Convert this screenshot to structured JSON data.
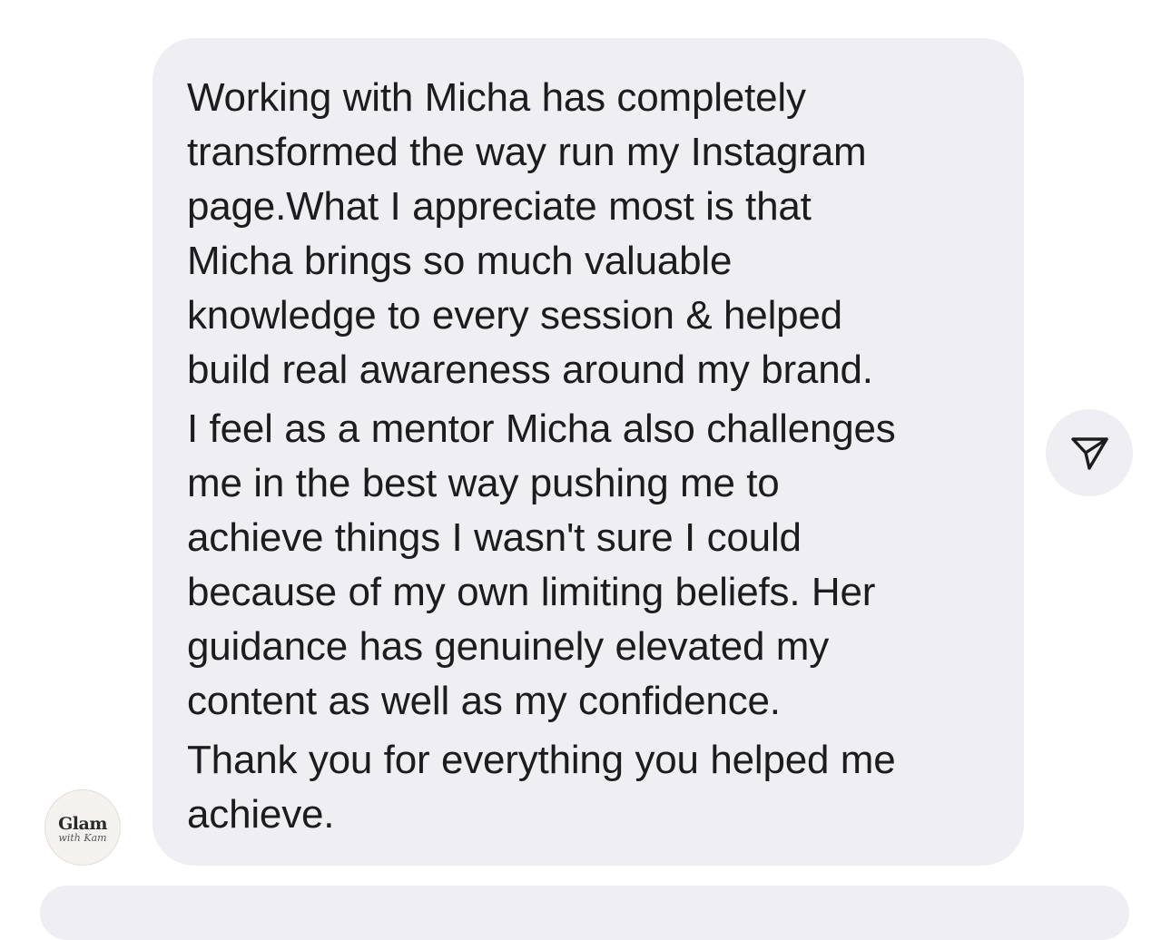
{
  "message": {
    "paragraphs": [
      {
        "lines": [
          "Working with Micha has completely",
          "transformed the way run my Instagram",
          "page.What I appreciate most is that",
          "Micha brings so much valuable",
          "knowledge to every session & helped",
          "build real awareness around my brand."
        ]
      },
      {
        "lines": [
          "I feel as a mentor Micha also challenges",
          "me in the best way pushing me to",
          "achieve things I wasn't sure I could",
          "because of my own limiting beliefs. Her",
          "guidance has genuinely elevated my",
          "content as well as my confidence."
        ]
      },
      {
        "lines": [
          "Thank you for everything you helped me",
          "achieve."
        ]
      }
    ]
  },
  "avatar": {
    "logo_main": "Glam",
    "logo_sub": "with Kam"
  },
  "share_button": {
    "icon": "send-icon"
  },
  "colors": {
    "bubble_bg": "#efeff3",
    "text": "#1c1c1e",
    "icon": "#1c1c1e"
  }
}
